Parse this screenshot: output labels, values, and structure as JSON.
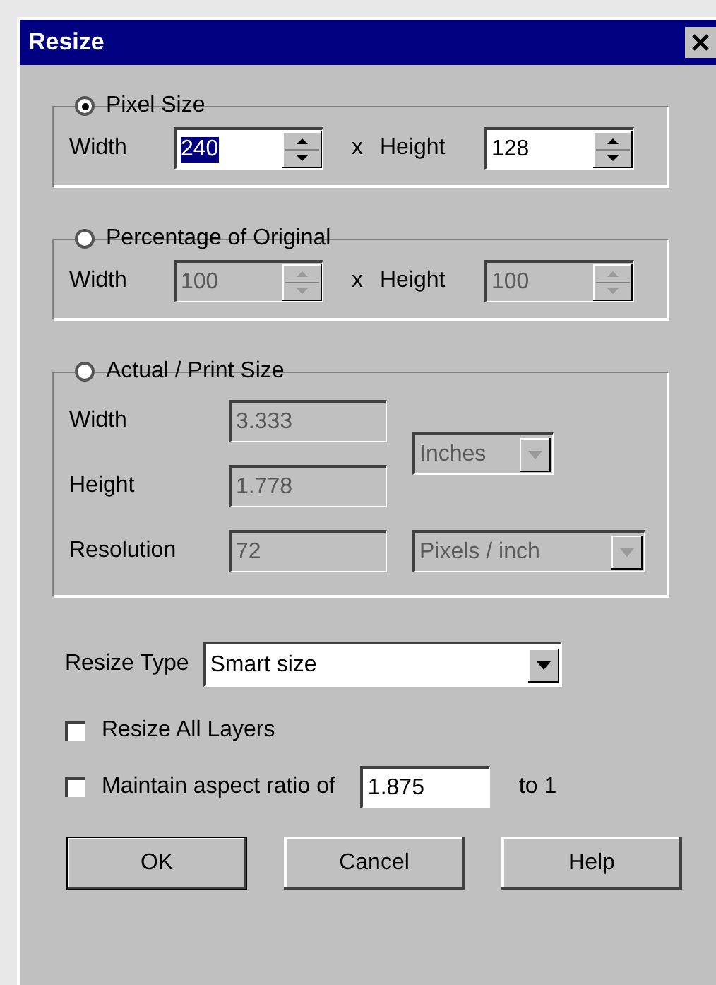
{
  "window": {
    "title": "Resize"
  },
  "groups": [
    {
      "kind": "pair",
      "label": "Pixel Size",
      "selected": true,
      "separator": "x",
      "fields": [
        {
          "label": "Width",
          "value": "240",
          "text_selected": true,
          "disabled": false
        },
        {
          "label": "Height",
          "value": "128",
          "text_selected": false,
          "disabled": false
        }
      ]
    },
    {
      "kind": "pair",
      "label": "Percentage of Original",
      "selected": false,
      "separator": "x",
      "fields": [
        {
          "label": "Width",
          "value": "100",
          "text_selected": false,
          "disabled": true
        },
        {
          "label": "Height",
          "value": "100",
          "text_selected": false,
          "disabled": true
        }
      ]
    },
    {
      "kind": "print",
      "label": "Actual / Print Size",
      "selected": false,
      "fields": [
        {
          "label": "Width",
          "value": "3.333",
          "disabled": true
        },
        {
          "label": "Height",
          "value": "1.778",
          "disabled": true
        },
        {
          "label": "Resolution",
          "value": "72",
          "disabled": true
        }
      ],
      "selects": [
        {
          "value": "Inches",
          "disabled": true
        },
        {
          "value": "Pixels / inch",
          "disabled": true
        }
      ]
    }
  ],
  "resize_type": {
    "label": "Resize Type",
    "value": "Smart size"
  },
  "options": [
    {
      "kind": "check",
      "label": "Resize All Layers",
      "checked": false
    },
    {
      "kind": "ratio",
      "label": "Maintain aspect ratio of",
      "checked": false,
      "value": "1.875",
      "suffix": "to 1"
    }
  ],
  "buttons": [
    "OK",
    "Cancel",
    "Help"
  ]
}
